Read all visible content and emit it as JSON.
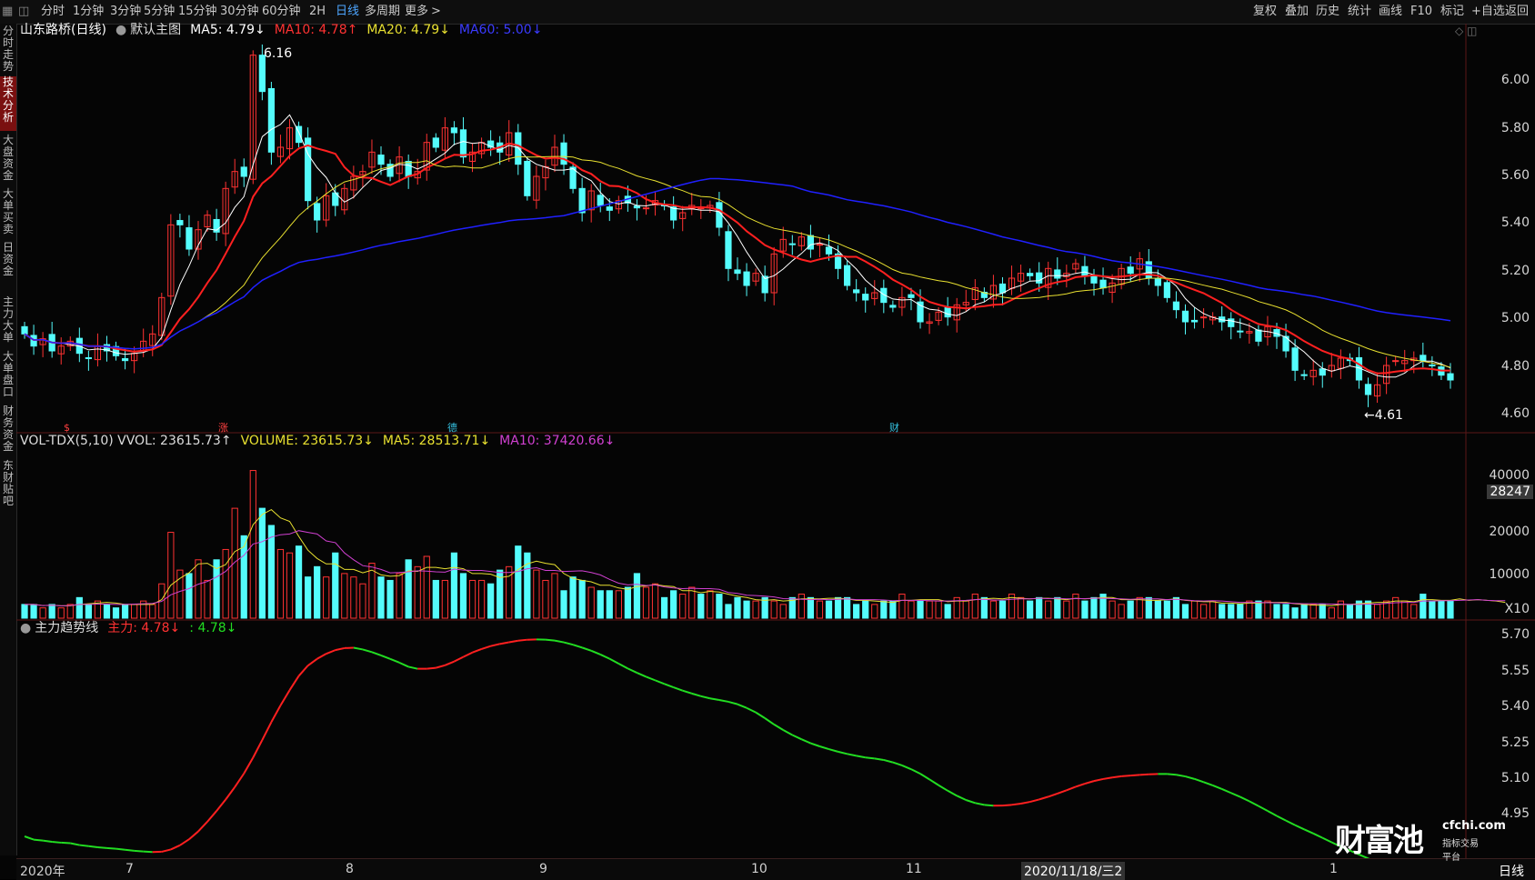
{
  "toolbar": {
    "left_items": [
      "分时",
      "1分钟",
      "3分钟",
      "5分钟",
      "15分钟",
      "30分钟",
      "60分钟",
      "2H",
      "日线",
      "多周期",
      "更多"
    ],
    "active_item": "日线",
    "right_items": [
      "复权",
      "叠加",
      "历史",
      "统计",
      "画线",
      "F10",
      "标记",
      "+自选",
      "返回"
    ]
  },
  "sidebar": {
    "tabs": [
      "分时走势",
      "技术分析",
      "大盘资金",
      "大单买卖",
      "日资金",
      "主力大单",
      "大单盘口",
      "财务资金",
      "东财贴吧"
    ],
    "active": "技术分析"
  },
  "price_pane": {
    "stock_name": "山东路桥(日线)",
    "template": "默认主图",
    "ma5": "MA5: 4.79↓",
    "ma10": "MA10: 4.78↑",
    "ma20": "MA20: 4.79↓",
    "ma60": "MA60: 5.00↓",
    "high_label": "6.16",
    "low_label": "←4.61",
    "axis": [
      "6.00",
      "5.80",
      "5.60",
      "5.40",
      "5.20",
      "5.00",
      "4.80",
      "4.60"
    ],
    "event_marks": [
      {
        "text": "$",
        "color": "#ff4040"
      },
      {
        "text": "涨",
        "color": "#ff4040"
      },
      {
        "text": "德",
        "color": "#35c0e0"
      },
      {
        "text": "财",
        "color": "#35c0e0"
      }
    ]
  },
  "volume_pane": {
    "title": "VOL-TDX(5,10) VVOL: 23615.73↑",
    "volume": "VOLUME: 23615.73↓",
    "ma5": "MA5: 28513.71↓",
    "ma10": "MA10: 37420.66↓",
    "axis": [
      "40000",
      "20000",
      "10000"
    ],
    "highlight_value": "28247",
    "unit": "X10"
  },
  "trend_pane": {
    "title": "主力趋势线",
    "main_force": "主力: 4.78↓",
    "second": ": 4.78↓",
    "axis": [
      "5.70",
      "5.55",
      "5.40",
      "5.25",
      "5.10",
      "4.95"
    ]
  },
  "date_axis": {
    "labels": [
      "2020年",
      "7",
      "8",
      "9",
      "10",
      "11",
      "2020/11/18/三2",
      "1"
    ],
    "period": "日线"
  },
  "brand": {
    "name": "财富池",
    "domain": "cfchi.com",
    "slogan": "指标交易平台"
  },
  "colors": {
    "up": "#ff3232",
    "down": "#54fcfc",
    "ma5": "#ffffff",
    "ma10": "#ff2020",
    "ma20": "#e8e030",
    "ma60": "#2020ff",
    "vma5": "#e8e030",
    "vma10": "#d040d0",
    "trend_up": "#ff2020",
    "trend_down": "#22dd22"
  },
  "chart_data": {
    "type": "candlestick",
    "ylim": [
      4.55,
      6.2
    ],
    "close": [
      4.95,
      4.9,
      4.93,
      4.88,
      4.9,
      4.92,
      4.87,
      4.85,
      4.9,
      4.88,
      4.86,
      4.84,
      4.87,
      4.92,
      4.95,
      5.1,
      5.4,
      5.4,
      5.3,
      5.38,
      5.44,
      5.37,
      5.55,
      5.62,
      5.6,
      6.1,
      5.95,
      5.7,
      5.72,
      5.8,
      5.74,
      5.5,
      5.42,
      5.52,
      5.48,
      5.55,
      5.6,
      5.62,
      5.7,
      5.65,
      5.6,
      5.68,
      5.6,
      5.62,
      5.74,
      5.72,
      5.8,
      5.78,
      5.68,
      5.7,
      5.74,
      5.72,
      5.7,
      5.78,
      5.65,
      5.52,
      5.6,
      5.64,
      5.72,
      5.65,
      5.55,
      5.45,
      5.54,
      5.48,
      5.46,
      5.5,
      5.49,
      5.47,
      5.47,
      5.5,
      5.48,
      5.42,
      5.45,
      5.48,
      5.47,
      5.48,
      5.39,
      5.22,
      5.2,
      5.15,
      5.2,
      5.12,
      5.28,
      5.34,
      5.32,
      5.35,
      5.3,
      5.32,
      5.28,
      5.22,
      5.15,
      5.12,
      5.09,
      5.12,
      5.08,
      5.06,
      5.1,
      5.1,
      5.0,
      5.0,
      5.04,
      5.02,
      5.07,
      5.08,
      5.14,
      5.1,
      5.15,
      5.12,
      5.18,
      5.2,
      5.19,
      5.16,
      5.22,
      5.18,
      5.2,
      5.24,
      5.19,
      5.16,
      5.14,
      5.16,
      5.22,
      5.2,
      5.26,
      5.18,
      5.15,
      5.1,
      5.05,
      5.0,
      5.0,
      5.02,
      5.02,
      5.0,
      4.98,
      4.96,
      4.96,
      4.92,
      4.98,
      4.94,
      4.88,
      4.8,
      4.78,
      4.8,
      4.78,
      4.82,
      4.85,
      4.84,
      4.76,
      4.7,
      4.74,
      4.82,
      4.84,
      4.84,
      4.85,
      4.84,
      4.82,
      4.78,
      4.76
    ],
    "volume": [
      4,
      4,
      3,
      4,
      3,
      4,
      6,
      4,
      5,
      4,
      3,
      4,
      4,
      5,
      4,
      10,
      25,
      14,
      13,
      17,
      11,
      17,
      20,
      32,
      24,
      43,
      32,
      27,
      20,
      19,
      21,
      12,
      15,
      12,
      19,
      13,
      12,
      10,
      16,
      12,
      11,
      13,
      17,
      15,
      18,
      11,
      11,
      19,
      13,
      11,
      11,
      10,
      14,
      15,
      21,
      19,
      14,
      11,
      13,
      8,
      12,
      11,
      9,
      8,
      8,
      8,
      9,
      13,
      9,
      10,
      6,
      8,
      7,
      9,
      7,
      8,
      7,
      4,
      6,
      5,
      5,
      6,
      5,
      4,
      6,
      7,
      6,
      5,
      5,
      6,
      6,
      4,
      5,
      4,
      5,
      5,
      7,
      5,
      5,
      5,
      5,
      4,
      6,
      5,
      7,
      6,
      5,
      5,
      7,
      6,
      5,
      6,
      5,
      6,
      5,
      7,
      5,
      6,
      7,
      5,
      4,
      5,
      6,
      6,
      5,
      5,
      6,
      4,
      5,
      4,
      5,
      4,
      4,
      4,
      5,
      5,
      5,
      4,
      4,
      3,
      4,
      4,
      4,
      3,
      5,
      4,
      5,
      5,
      4,
      5,
      6,
      5,
      4,
      7,
      5,
      5,
      5,
      6,
      5,
      6,
      4,
      4,
      4
    ]
  }
}
